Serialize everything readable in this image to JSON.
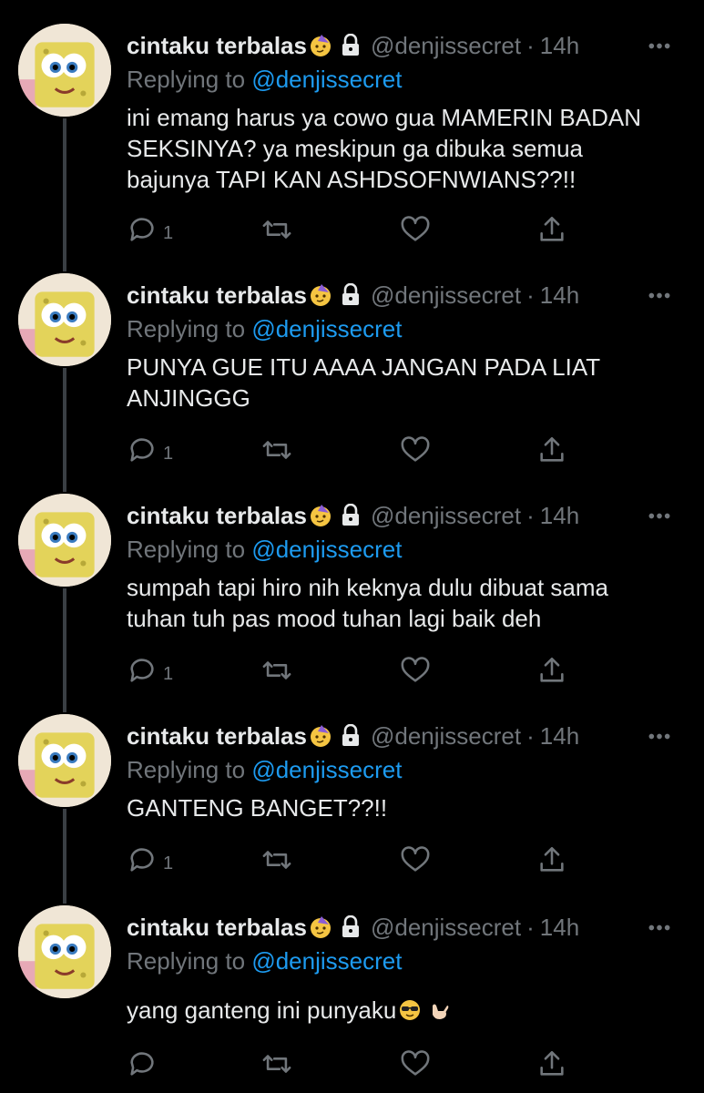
{
  "author": {
    "name": "cintaku terbalas",
    "handle": "@denjissecret",
    "time": "14h",
    "dot": "·"
  },
  "reply_prefix": "Replying to",
  "reply_mention": "@denjissecret",
  "tweets": [
    {
      "text_lines": [
        "ini emang harus ya cowo gua MAMERIN BADAN",
        "SEKSINYA? ya meskipun ga dibuka semua",
        "bajunya TAPI KAN ASHDSOFNWIANS??!!"
      ],
      "reply_count": "1"
    },
    {
      "text_lines": [
        "PUNYA GUE ITU AAAA JANGAN PADA LIAT",
        "ANJINGGG"
      ],
      "reply_count": "1"
    },
    {
      "text_lines": [
        "sumpah tapi hiro nih keknya dulu dibuat sama",
        "tuhan tuh pas mood tuhan lagi baik deh"
      ],
      "reply_count": "1"
    },
    {
      "text_lines": [
        "GANTENG BANGET??!!"
      ],
      "reply_count": "1"
    },
    {
      "text_lines": [
        "yang ganteng ini punyaku"
      ],
      "reply_count": ""
    }
  ],
  "icons": {
    "name_emoji": "partying-face-emoji",
    "lock": "lock-icon",
    "more": "more-icon",
    "reply": "reply-icon",
    "retweet": "retweet-icon",
    "like": "heart-icon",
    "share": "share-icon",
    "trailing_emojis": [
      "sunglasses-emoji",
      "call-me-hand-emoji"
    ]
  },
  "colors": {
    "background": "#000000",
    "text": "#e7e9ea",
    "secondary": "#71767b",
    "accent": "#1d9bf0",
    "thread_line": "#3a3f44"
  }
}
